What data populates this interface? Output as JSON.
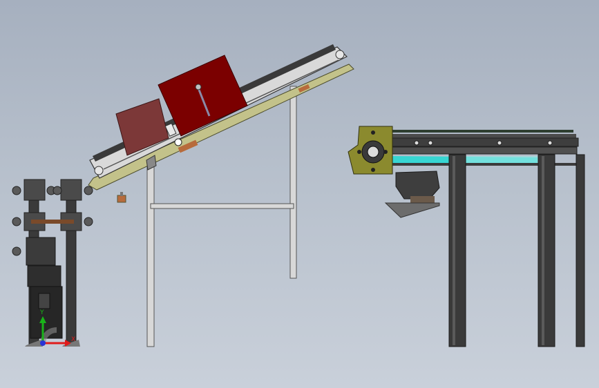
{
  "viewport": {
    "background_top": "#a6b0bf",
    "background_bottom": "#c9d0da"
  },
  "views": [
    {
      "name": "end-view"
    },
    {
      "name": "inclined-conveyor-side-view"
    },
    {
      "name": "horizontal-conveyor-side-view"
    }
  ],
  "colors": {
    "frame_dark": "#3c3c3c",
    "leg_steel": "#d4d4d4",
    "belt_plate": "#c3c28a",
    "carton_large": "#7b0000",
    "carton_small": "#7c3838",
    "drive_housing": "#8b8a2e",
    "belt_cyan": "#37d6d3",
    "sensor_copper": "#b76b3c",
    "axis_x": "#e01b1b",
    "axis_y": "#19b319",
    "axis_z": "#2a33d6"
  },
  "triad": {
    "x_label": "X",
    "y_label": "Y"
  }
}
